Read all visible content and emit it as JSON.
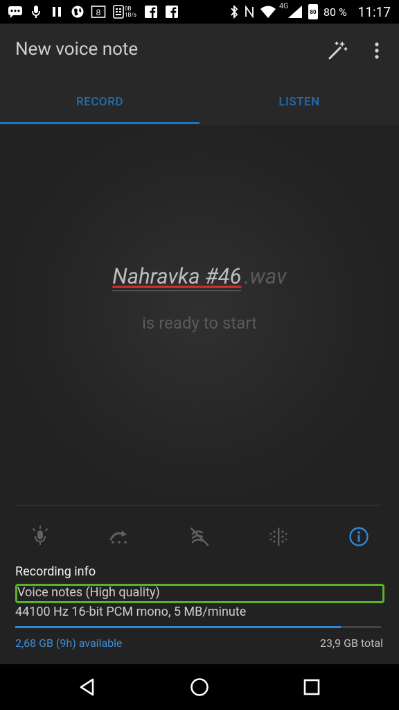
{
  "status_bar": {
    "left_icons": [
      "chat-icon",
      "mic-icon",
      "pause-icon",
      "globe-icon",
      "calendar-icon",
      "keyboard-icon",
      "facebook-icon",
      "facebook-icon"
    ],
    "network_speed_1": "0B",
    "network_speed_2": "1B/s",
    "calendar_day": "8",
    "network": "4G",
    "battery_level": "80",
    "battery_percent": "80 %",
    "time": "11:17"
  },
  "app_bar": {
    "title": "New voice note"
  },
  "tabs": {
    "record": "RECORD",
    "listen": "LISTEN",
    "active": "record"
  },
  "recording": {
    "filename": "Nahravka #46",
    "extension": ".wav",
    "status": "is ready to start"
  },
  "info": {
    "heading": "Recording info",
    "quality_preset": "Voice notes (High quality)",
    "format": "44100 Hz 16-bit PCM mono, 5 MB/minute",
    "available": "2,68 GB (9h) available",
    "total": "23,9 GB total",
    "storage_available_fraction": 0.89
  },
  "colors": {
    "accent": "#1d76c2",
    "highlight_box": "#5cb12c"
  }
}
